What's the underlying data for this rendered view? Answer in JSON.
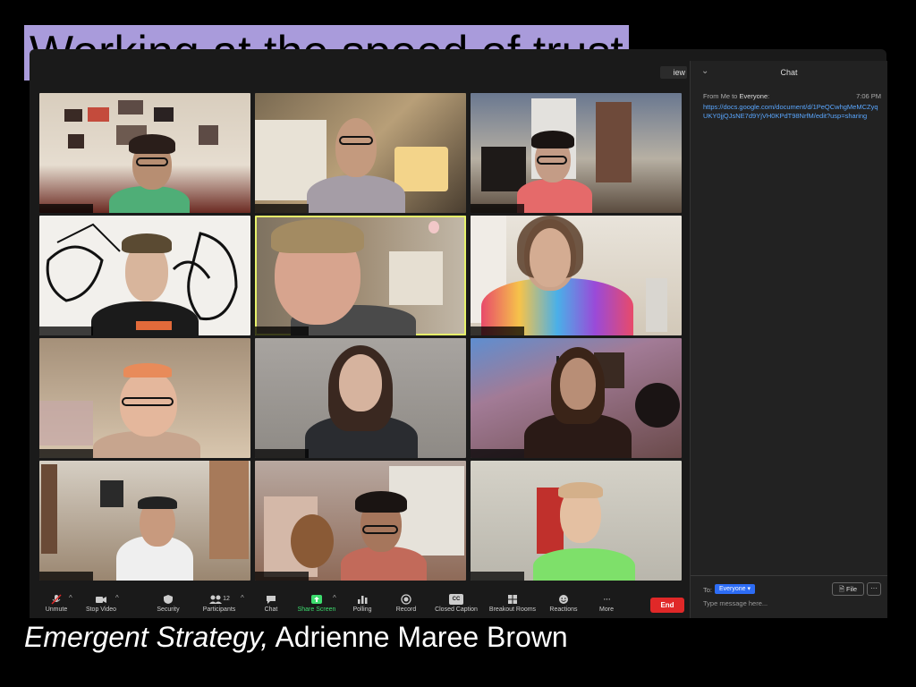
{
  "slide": {
    "title": "Working at the speed of trust",
    "caption_italic": "Emergent Strategy,",
    "caption_rest": " Adrienne Maree Brown"
  },
  "window": {
    "view_label": "iew"
  },
  "chat": {
    "title": "Chat",
    "from_prefix": "From Me to ",
    "from_target": "Everyone",
    "from_suffix": ":",
    "time": "7:06 PM",
    "message": "https://docs.google.com/document/d/1PeQCwhgMeMCZyqUKY0jjQJsNE7d9YjVH0KPdT98NrfM/edit?usp=sharing",
    "to_label": "To:",
    "to_value": "Everyone",
    "file_label": "File",
    "more_label": "···",
    "input_placeholder": "Type message here..."
  },
  "toolbar": {
    "items": [
      {
        "label": "Unmute",
        "icon": "microphone-muted-icon"
      },
      {
        "label": "Stop Video",
        "icon": "video-camera-icon"
      },
      {
        "label": "Security",
        "icon": "shield-icon"
      },
      {
        "label": "Participants",
        "icon": "participants-icon",
        "count": "12"
      },
      {
        "label": "Chat",
        "icon": "chat-bubble-icon"
      },
      {
        "label": "Share Screen",
        "icon": "share-screen-icon"
      },
      {
        "label": "Polling",
        "icon": "bar-chart-icon"
      },
      {
        "label": "Record",
        "icon": "record-icon"
      },
      {
        "label": "Closed Caption",
        "icon": "closed-caption-icon",
        "icon_text": "CC"
      },
      {
        "label": "Breakout Rooms",
        "icon": "breakout-rooms-icon"
      },
      {
        "label": "Reactions",
        "icon": "reaction-emoji-icon"
      },
      {
        "label": "More",
        "icon": "more-dots-icon",
        "icon_text": "···"
      }
    ],
    "end_label": "End"
  },
  "colors": {
    "title_highlight": "#a99bdb",
    "share_green": "#3ddc6e",
    "end_red": "#e02828",
    "link_blue": "#5aa7ff",
    "active_speaker": "#e6f26a"
  }
}
